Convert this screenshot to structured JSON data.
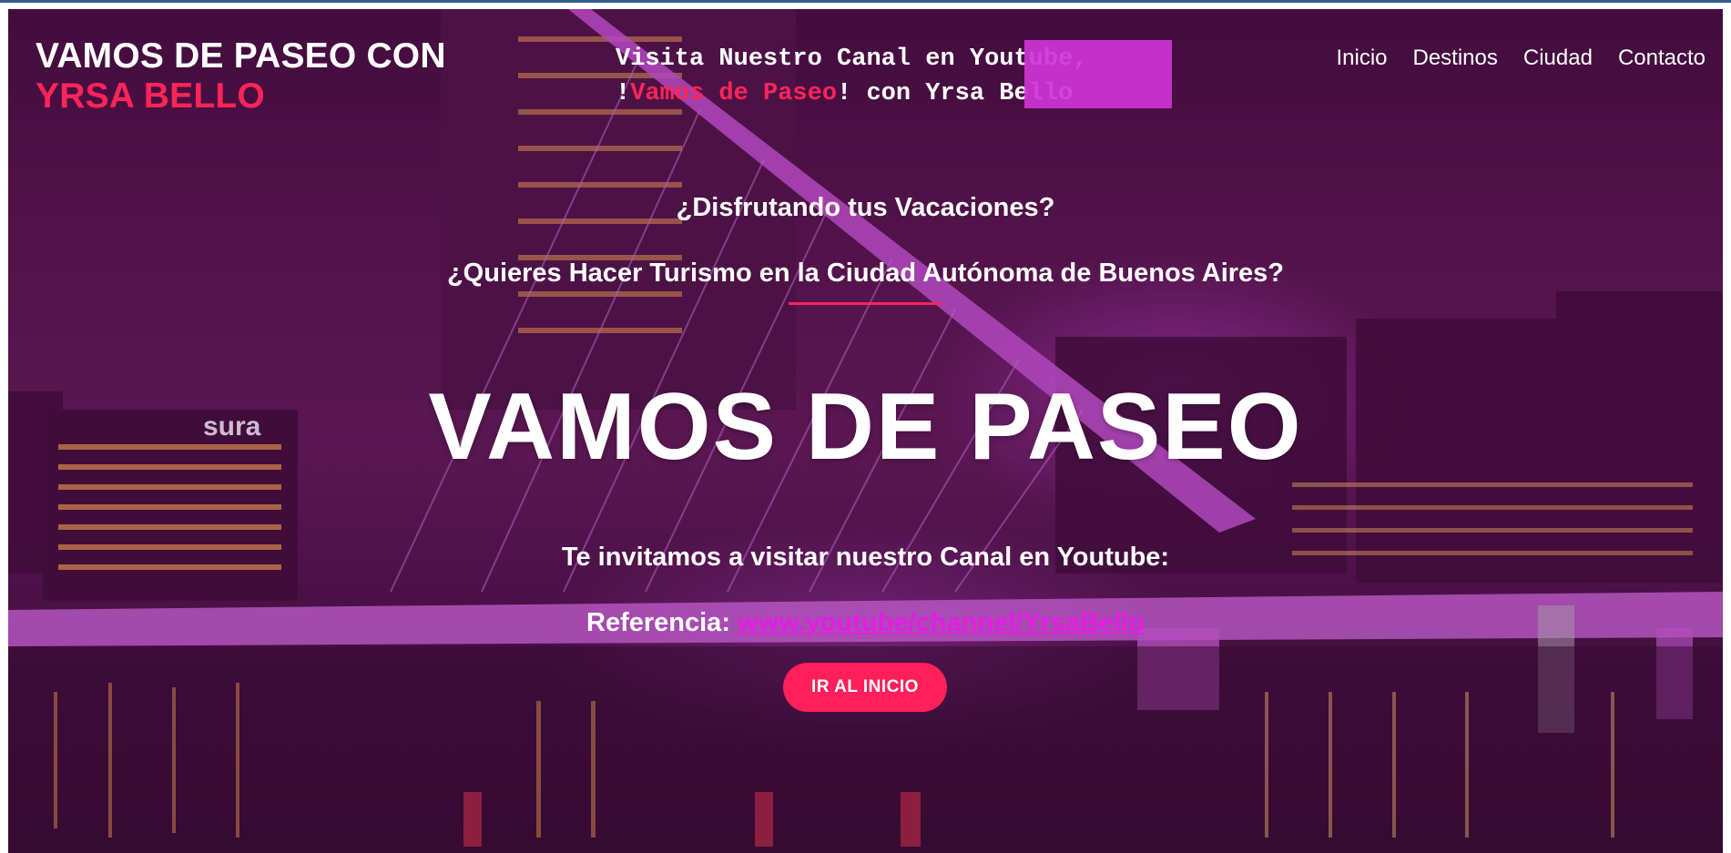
{
  "brand": {
    "line1": "VAMOS DE PASEO CON",
    "line2": "YRSA BELLO"
  },
  "marquee": {
    "line1": "Visita Nuestro Canal en Youtube,",
    "line2_prefix": "!",
    "line2_highlight": "Vamos de Paseo",
    "line2_suffix": "! con Yrsa Bello"
  },
  "nav": {
    "items": [
      "Inicio",
      "Destinos",
      "Ciudad",
      "Contacto"
    ]
  },
  "hero": {
    "question1": "¿Disfrutando tus Vacaciones?",
    "question2": "¿Quieres Hacer Turismo en la Ciudad Autónoma de Buenos Aires?",
    "headline": "VAMOS DE PASEO",
    "invite": "Te invitamos a visitar nuestro Canal en Youtube:",
    "ref_label": "Referencia:",
    "ref_link": "www.youtube/channel/YrsaBello",
    "cta": "IR AL INICIO",
    "building_sign": "sura"
  },
  "colors": {
    "accent": "#ff2357",
    "link": "#e51ce4",
    "overlay": "#5b1752"
  }
}
